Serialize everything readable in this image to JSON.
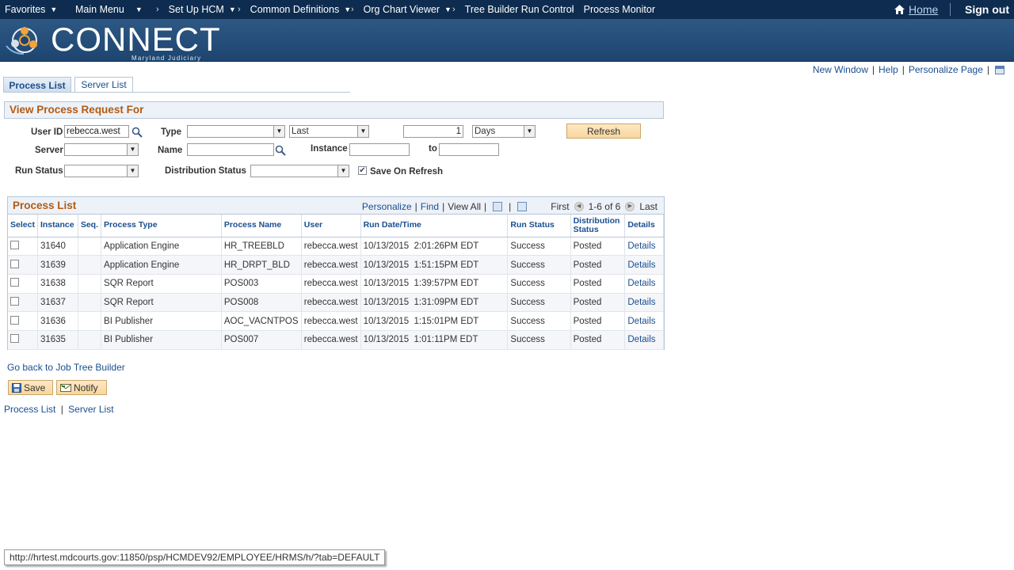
{
  "topnav": {
    "favorites": "Favorites",
    "main_menu": "Main Menu",
    "breadcrumbs": [
      "Set Up HCM",
      "Common Definitions",
      "Org Chart Viewer",
      "Tree Builder Run Control",
      "Process Monitor"
    ],
    "home": "Home",
    "signout": "Sign out"
  },
  "banner": {
    "logo_text": "CONNECT",
    "logo_sub": "Maryland Judiciary"
  },
  "pagelinks": {
    "new_window": "New Window",
    "help": "Help",
    "personalize": "Personalize Page"
  },
  "tabs": {
    "process_list": "Process List",
    "server_list": "Server List"
  },
  "section": {
    "title": "View Process Request For"
  },
  "form": {
    "user_id_label": "User ID",
    "user_id_value": "rebecca.west",
    "type_label": "Type",
    "type_value": "",
    "range_value": "Last",
    "range_number": "1",
    "range_unit": "Days",
    "refresh": "Refresh",
    "server_label": "Server",
    "server_value": "",
    "name_label": "Name",
    "name_value": "",
    "instance_label": "Instance",
    "instance_from": "",
    "to_label": "to",
    "instance_to": "",
    "run_status_label": "Run Status",
    "run_status_value": "",
    "dist_status_label": "Distribution Status",
    "dist_status_value": "",
    "save_on_refresh_label": "Save On Refresh",
    "save_on_refresh_checked": true
  },
  "grid": {
    "title": "Process List",
    "personalize": "Personalize",
    "find": "Find",
    "view_all": "View All",
    "first": "First",
    "range": "1-6 of 6",
    "last": "Last",
    "columns": [
      "Select",
      "Instance",
      "Seq.",
      "Process Type",
      "Process Name",
      "User",
      "Run Date/Time",
      "Run Status",
      "Distribution Status",
      "Details"
    ],
    "rows": [
      {
        "instance": "31640",
        "seq": "",
        "type": "Application Engine",
        "name": "HR_TREEBLD",
        "user": "rebecca.west",
        "datetime": "10/13/2015  2:01:26PM EDT",
        "run_status": "Success",
        "dist_status": "Posted",
        "details": "Details"
      },
      {
        "instance": "31639",
        "seq": "",
        "type": "Application Engine",
        "name": "HR_DRPT_BLD",
        "user": "rebecca.west",
        "datetime": "10/13/2015  1:51:15PM EDT",
        "run_status": "Success",
        "dist_status": "Posted",
        "details": "Details"
      },
      {
        "instance": "31638",
        "seq": "",
        "type": "SQR Report",
        "name": "POS003",
        "user": "rebecca.west",
        "datetime": "10/13/2015  1:39:57PM EDT",
        "run_status": "Success",
        "dist_status": "Posted",
        "details": "Details"
      },
      {
        "instance": "31637",
        "seq": "",
        "type": "SQR Report",
        "name": "POS008",
        "user": "rebecca.west",
        "datetime": "10/13/2015  1:31:09PM EDT",
        "run_status": "Success",
        "dist_status": "Posted",
        "details": "Details"
      },
      {
        "instance": "31636",
        "seq": "",
        "type": "BI Publisher",
        "name": "AOC_VACNTPOS",
        "user": "rebecca.west",
        "datetime": "10/13/2015  1:15:01PM EDT",
        "run_status": "Success",
        "dist_status": "Posted",
        "details": "Details"
      },
      {
        "instance": "31635",
        "seq": "",
        "type": "BI Publisher",
        "name": "POS007",
        "user": "rebecca.west",
        "datetime": "10/13/2015  1:01:11PM EDT",
        "run_status": "Success",
        "dist_status": "Posted",
        "details": "Details"
      }
    ]
  },
  "actions": {
    "go_back": "Go back to Job Tree Builder",
    "save": "Save",
    "notify": "Notify"
  },
  "bottom_links": {
    "process_list": "Process List",
    "server_list": "Server List"
  },
  "status_bar": {
    "url": "http://hrtest.mdcourts.gov:11850/psp/HCMDEV92/EMPLOYEE/HRMS/h/?tab=DEFAULT"
  },
  "colors": {
    "nav_bg": "#0e2c4f",
    "banner_bg": "#2e5884",
    "section_title": "#b35a12",
    "link": "#1a4e8f",
    "button_bg": "#f9d79b"
  }
}
